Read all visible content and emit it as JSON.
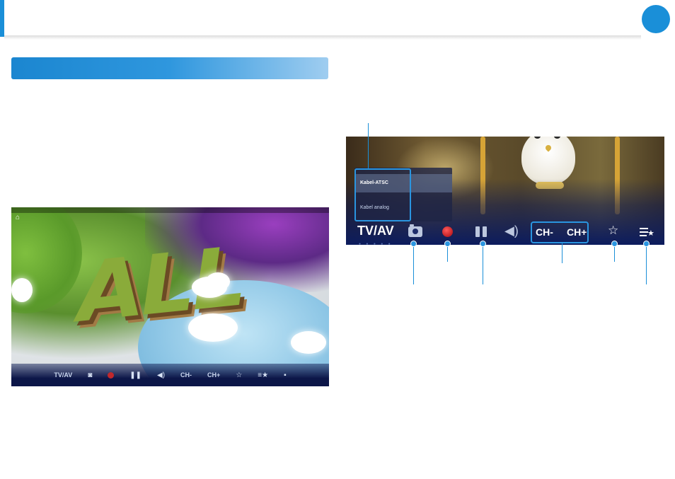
{
  "left_screenshot": {
    "big_text": "ALL",
    "toolbar": {
      "source_label": "TV/AV",
      "ch_minus": "CH-",
      "ch_plus": "CH+"
    }
  },
  "right_screenshot": {
    "source_menu": {
      "items": [
        "Kabel-ATSC",
        "Kabel analog"
      ],
      "selected": "Kabel-ATSC"
    },
    "source_label": "TV/AV",
    "ch_minus": "CH-",
    "ch_plus": "CH+"
  },
  "icons": {
    "camera": "camera-icon",
    "record": "record-icon",
    "pause": "pause-icon",
    "volume": "volume-icon",
    "favorite": "star-icon",
    "favorites_list": "favorites-list-icon",
    "more": "more-icon",
    "home": "home-icon"
  },
  "colors": {
    "accent": "#1a8fd8",
    "toolbar": "#0c1c5e",
    "record": "#c11f24"
  }
}
